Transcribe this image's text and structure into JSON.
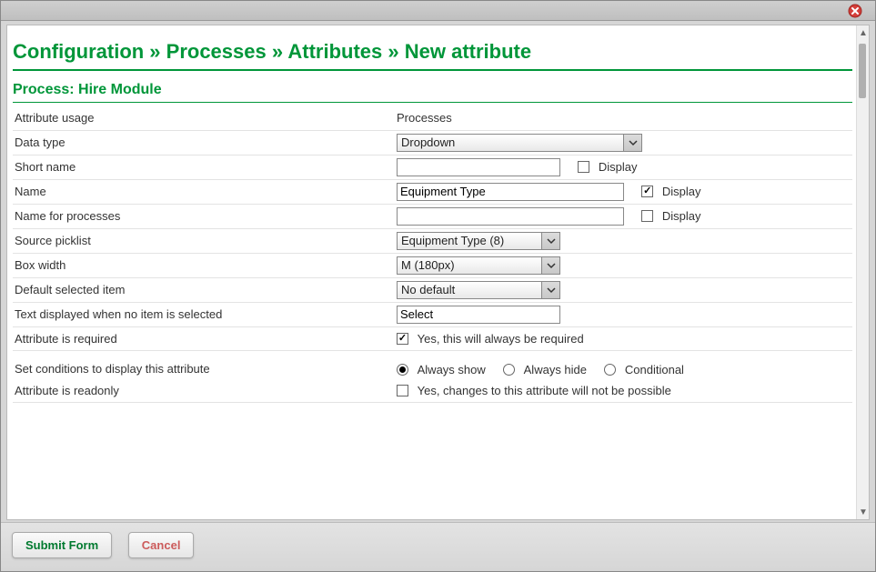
{
  "breadcrumbs": {
    "segments": [
      "Configuration",
      "Processes",
      "Attributes",
      "New attribute"
    ],
    "display": "Configuration » Processes » Attributes » New attribute"
  },
  "section_title": "Process: Hire Module",
  "fields": {
    "attribute_usage": {
      "label": "Attribute usage",
      "value": "Processes"
    },
    "data_type": {
      "label": "Data type",
      "value": "Dropdown"
    },
    "short_name": {
      "label": "Short name",
      "value": "",
      "display_label": "Display",
      "display_checked": false
    },
    "name": {
      "label": "Name",
      "value": "Equipment Type",
      "display_label": "Display",
      "display_checked": true
    },
    "name_for_processes": {
      "label": "Name for processes",
      "value": "",
      "display_label": "Display",
      "display_checked": false
    },
    "source_picklist": {
      "label": "Source picklist",
      "value": "Equipment Type (8)"
    },
    "box_width": {
      "label": "Box width",
      "value": "M (180px)"
    },
    "default_selected_item": {
      "label": "Default selected item",
      "value": "No default"
    },
    "placeholder_text": {
      "label": "Text displayed when no item is selected",
      "value": "Select"
    },
    "attribute_required": {
      "label": "Attribute is required",
      "checked": true,
      "text": "Yes, this will always be required"
    },
    "display_conditions": {
      "label": "Set conditions to display this attribute",
      "options": [
        "Always show",
        "Always hide",
        "Conditional"
      ],
      "selected": "Always show"
    },
    "attribute_readonly": {
      "label": "Attribute is readonly",
      "checked": false,
      "text": "Yes, changes to this attribute will not be possible"
    }
  },
  "footer": {
    "submit": "Submit Form",
    "cancel": "Cancel"
  }
}
